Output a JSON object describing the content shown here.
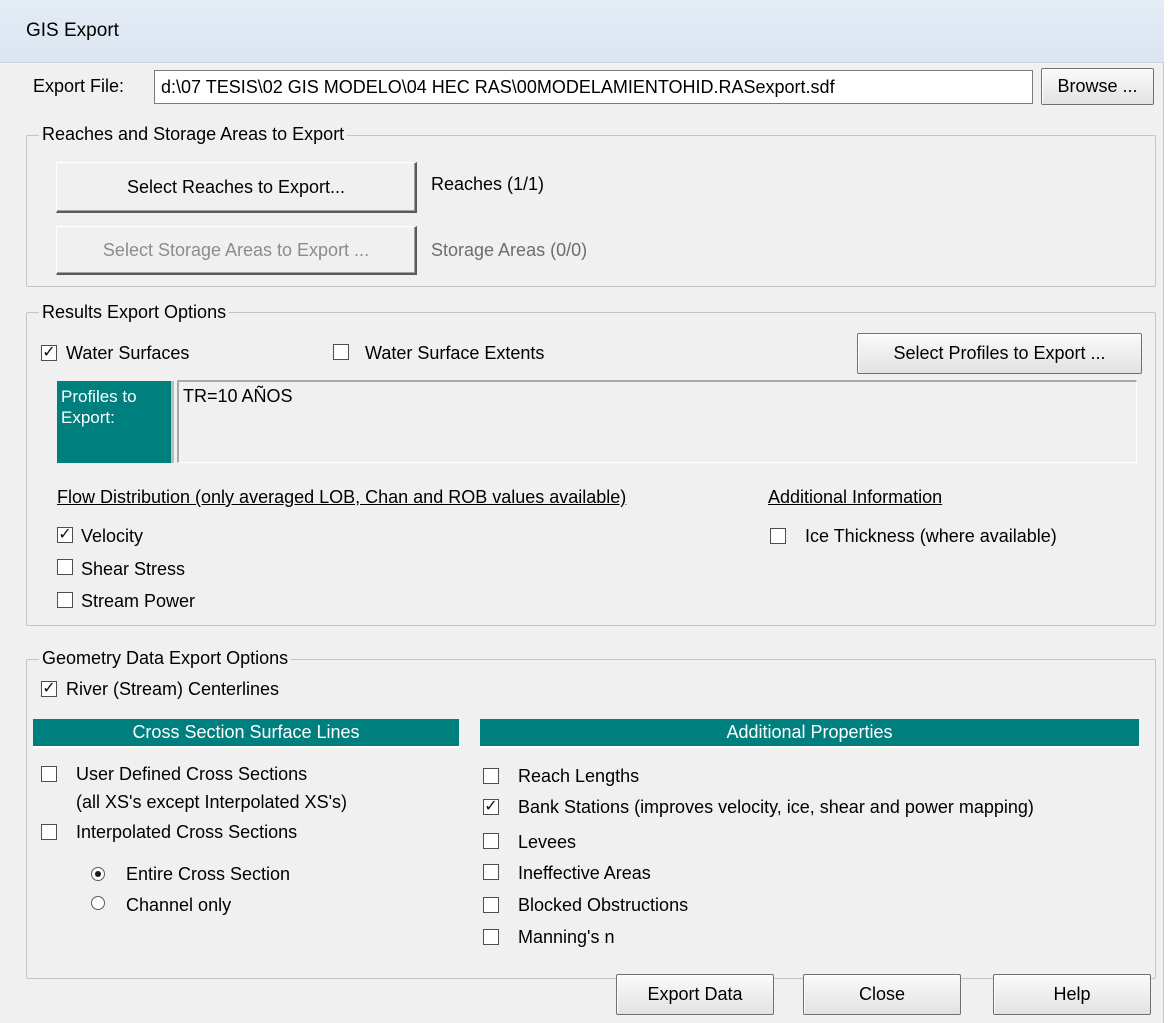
{
  "window": {
    "title": "GIS Export"
  },
  "export_file": {
    "label": "Export File:",
    "value": "d:\\07 TESIS\\02 GIS MODELO\\04 HEC RAS\\00MODELAMIENTOHID.RASexport.sdf",
    "browse_label": "Browse ..."
  },
  "reaches_group": {
    "title": "Reaches and Storage Areas to Export",
    "select_reaches_label": "Select Reaches to Export...",
    "reaches_status": "Reaches (1/1)",
    "select_storage_label": "Select Storage Areas to Export ...",
    "storage_status": "Storage Areas (0/0)"
  },
  "results_group": {
    "title": "Results Export Options",
    "water_surfaces": {
      "label": "Water Surfaces",
      "checked": true
    },
    "water_surface_extents": {
      "label": "Water Surface Extents",
      "checked": false
    },
    "select_profiles_label": "Select Profiles to Export ...",
    "profiles_header_line1": "Profiles to",
    "profiles_header_line2": "Export:",
    "profiles_list": [
      "TR=10 AÑOS"
    ],
    "flow_distribution_label": "Flow Distribution (only averaged LOB, Chan and ROB values available)",
    "velocity": {
      "label": "Velocity",
      "checked": true
    },
    "shear_stress": {
      "label": "Shear Stress",
      "checked": false
    },
    "stream_power": {
      "label": "Stream Power",
      "checked": false
    },
    "additional_info_label": "Additional Information",
    "ice_thickness": {
      "label": "Ice Thickness (where available)",
      "checked": false
    }
  },
  "geometry_group": {
    "title": "Geometry Data Export Options",
    "river_centerlines": {
      "label": "River (Stream) Centerlines",
      "checked": true
    },
    "xs_header": "Cross Section Surface Lines",
    "user_defined_xs": {
      "label": "User Defined Cross Sections",
      "checked": false
    },
    "user_defined_note": "(all XS's except Interpolated XS's)",
    "interpolated_xs": {
      "label": "Interpolated Cross Sections",
      "checked": false
    },
    "entire_cross_section": {
      "label": "Entire Cross Section",
      "selected": true
    },
    "channel_only": {
      "label": "Channel only",
      "selected": false
    },
    "additional_header": "Additional Properties",
    "reach_lengths": {
      "label": "Reach Lengths",
      "checked": false
    },
    "bank_stations": {
      "label": "Bank Stations (improves velocity, ice, shear and power mapping)",
      "checked": true
    },
    "levees": {
      "label": "Levees",
      "checked": false
    },
    "ineffective_areas": {
      "label": "Ineffective Areas",
      "checked": false
    },
    "blocked_obstructions": {
      "label": "Blocked Obstructions",
      "checked": false
    },
    "mannings_n": {
      "label": "Manning's n",
      "checked": false
    }
  },
  "footer": {
    "export_label": "Export Data",
    "close_label": "Close",
    "help_label": "Help"
  },
  "colors": {
    "teal_header": "#007f7f",
    "window_bg": "#f0f0f0",
    "titlebar": "#dbe5f1"
  },
  "icons": {
    "check": "check-mark-icon",
    "radio": "radio-dot-icon"
  }
}
